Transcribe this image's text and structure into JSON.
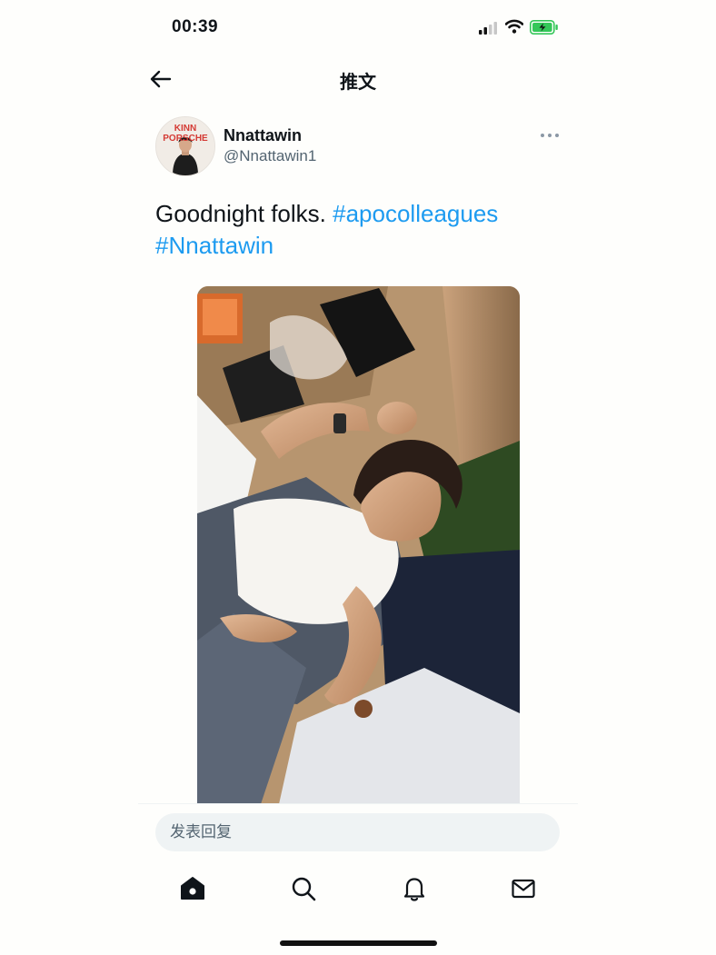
{
  "status_bar": {
    "time": "00:39",
    "icons": [
      "signal-icon",
      "wifi-icon",
      "battery-charging-icon"
    ],
    "battery_color": "#34c759"
  },
  "nav": {
    "title": "推文",
    "back_icon": "arrow-left-icon"
  },
  "tweet": {
    "author": {
      "display_name": "Nnattawin",
      "handle": "@Nnattawin1",
      "avatar_text_line1": "KINN",
      "avatar_text_line2": "PORSCHE"
    },
    "text": "Goodnight folks.",
    "hashtags": [
      "#apocolleagues",
      "#Nnattawin"
    ],
    "more_icon": "more-horizontal-icon",
    "media_icon": "photo"
  },
  "reply": {
    "placeholder": "发表回复"
  },
  "tabs": [
    {
      "name": "home",
      "icon": "home-icon",
      "active": true
    },
    {
      "name": "search",
      "icon": "search-icon",
      "active": false
    },
    {
      "name": "notifications",
      "icon": "bell-icon",
      "active": false
    },
    {
      "name": "messages",
      "icon": "mail-icon",
      "active": false
    }
  ],
  "colors": {
    "accent": "#1d9bf0",
    "text": "#0f1419",
    "secondary_text": "#536471",
    "input_bg": "#eff3f4"
  }
}
